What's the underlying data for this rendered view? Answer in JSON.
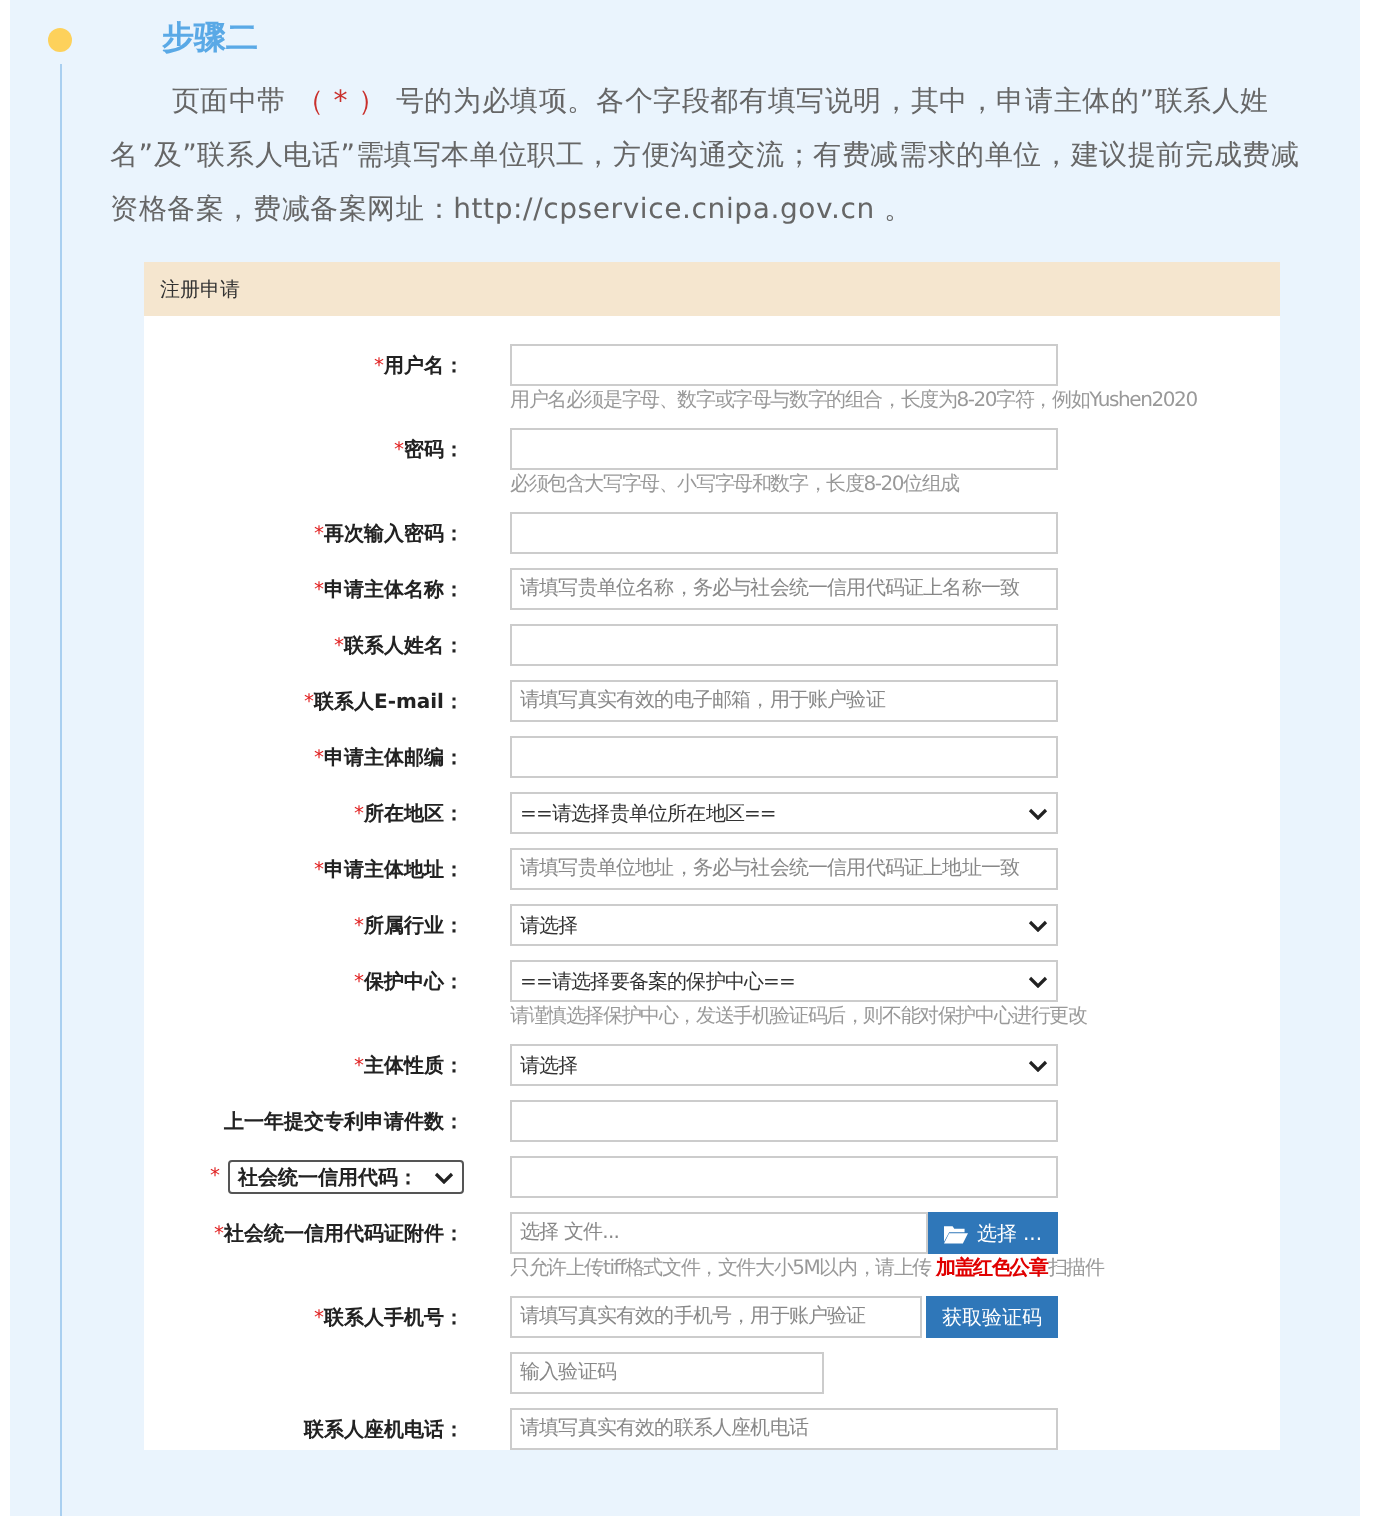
{
  "step": {
    "title": "步骤二",
    "intro": "页面中带 **（ * ）** 号的为必填项。各个字段都有填写说明，其中，申请主体的”联系人姓名”及”联系人电话”需填写本单位职工，方便沟通交流；有费减需求的单位，建议提前完成费减资格备案，费减备案网址：http://cpservice.cnipa.gov.cn 。"
  },
  "form": {
    "title": "注册申请",
    "fields": [
      {
        "kind": "text",
        "mark": "*",
        "label": "用户名：",
        "hint": "用户名必须是字母、数字或字母与数字的组合，长度为8-20字符，例如Yushen2020"
      },
      {
        "kind": "text",
        "mark": "*",
        "label": "密码：",
        "hint": "必须包含大写字母、小写字母和数字，长度8-20位组成"
      },
      {
        "kind": "text",
        "mark": "*",
        "label": "再次输入密码："
      },
      {
        "kind": "text",
        "mark": "*",
        "label": "申请主体名称：",
        "placeholder": "请填写贵单位名称，务必与社会统一信用代码证上名称一致"
      },
      {
        "kind": "text",
        "mark": "*",
        "label": "联系人姓名："
      },
      {
        "kind": "text",
        "mark": "*",
        "label": "联系人E-mail：",
        "placeholder": "请填写真实有效的电子邮箱，用于账户验证"
      },
      {
        "kind": "text",
        "mark": "*",
        "label": "申请主体邮编："
      },
      {
        "kind": "select",
        "mark": "*",
        "label": "所在地区：",
        "value": "==请选择贵单位所在地区=="
      },
      {
        "kind": "text",
        "mark": "*",
        "label": "申请主体地址：",
        "placeholder": "请填写贵单位地址，务必与社会统一信用代码证上地址一致"
      },
      {
        "kind": "select",
        "mark": "*",
        "label": "所属行业：",
        "value": "请选择"
      },
      {
        "kind": "select",
        "mark": "*",
        "label": "保护中心：",
        "value": "==请选择要备案的保护中心==",
        "hint": "请谨慎选择保护中心，发送手机验证码后，则不能对保护中心进行更改"
      },
      {
        "kind": "select",
        "mark": "*",
        "label": "主体性质：",
        "value": "请选择"
      },
      {
        "kind": "text",
        "label": "上一年提交专利申请件数："
      },
      {
        "kind": "select-label",
        "mark": "*",
        "label": "社会统一信用代码："
      },
      {
        "kind": "file",
        "mark": "*",
        "label": "社会统一信用代码证附件：",
        "placeholder": "选择 文件...",
        "button": "选择 ...",
        "hint": "只允许上传tiff格式文件，文件大小5M以内，请上传 **加盖红色公章**扫描件"
      },
      {
        "kind": "phone",
        "mark": "*",
        "label": "联系人手机号：",
        "placeholder": "请填写真实有效的手机号，用于账户验证",
        "button": "获取验证码"
      },
      {
        "kind": "code",
        "placeholder": "输入验证码"
      },
      {
        "kind": "text",
        "label": "联系人座机电话：",
        "placeholder": "请填写真实有效的联系人座机电话"
      }
    ]
  }
}
